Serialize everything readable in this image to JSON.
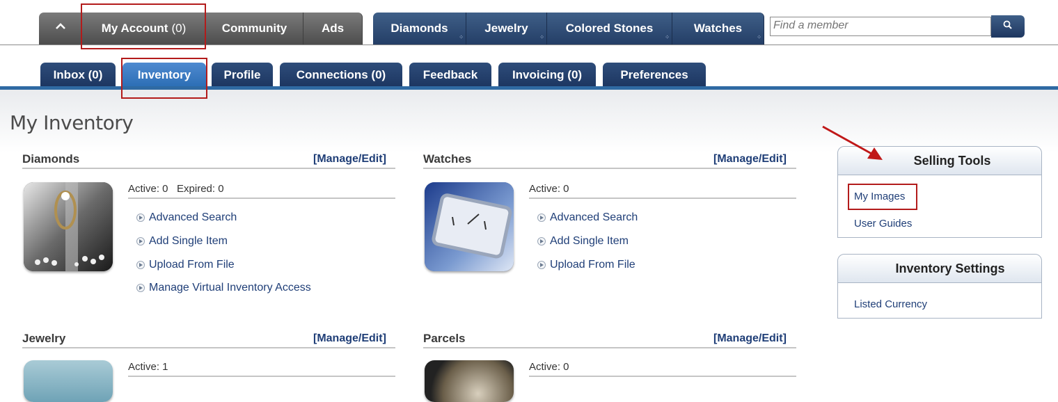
{
  "top_nav": {
    "home_icon": "home-icon",
    "my_account": {
      "label": "My Account",
      "count": "(0)"
    },
    "community": "Community",
    "ads": "Ads",
    "diamonds": "Diamonds",
    "jewelry": "Jewelry",
    "colored_stones": "Colored Stones",
    "watches": "Watches",
    "search_placeholder": "Find a member",
    "search_icon": "search-icon"
  },
  "sub_tabs": [
    "Inbox (0)",
    "Inventory",
    "Profile",
    "Connections (0)",
    "Feedback",
    "Invoicing (0)",
    "Preferences"
  ],
  "page_title": "My Inventory",
  "sections": {
    "diamonds": {
      "title": "Diamonds",
      "manage": "[Manage/Edit]",
      "stats": "Active: 0   Expired: 0",
      "links": [
        "Advanced Search",
        "Add Single Item",
        "Upload From File",
        "Manage Virtual Inventory Access"
      ]
    },
    "watches": {
      "title": "Watches",
      "manage": "[Manage/Edit]",
      "stats": "Active: 0",
      "links": [
        "Advanced Search",
        "Add Single Item",
        "Upload From File"
      ]
    },
    "jewelry": {
      "title": "Jewelry",
      "manage": "[Manage/Edit]",
      "stats": "Active: 1"
    },
    "parcels": {
      "title": "Parcels",
      "manage": "[Manage/Edit]",
      "stats": "Active: 0"
    }
  },
  "selling_tools": {
    "title": "Selling Tools",
    "links": [
      "My Images",
      "User Guides"
    ]
  },
  "inventory_settings": {
    "title": "Inventory Settings",
    "links": [
      "Listed Currency"
    ]
  },
  "colors": {
    "nav_blue": "#243e66",
    "active_tab": "#2b6db4",
    "link": "#1f3e77",
    "highlight": "#b31b1b"
  }
}
